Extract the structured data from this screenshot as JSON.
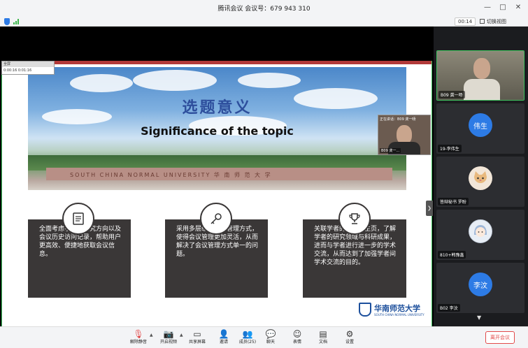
{
  "window": {
    "title": "腾讯会议 会议号：679 943 310"
  },
  "subbar": {
    "timer": "00:14",
    "switch_view": "切换视图"
  },
  "mini_player": {
    "label": "全屏",
    "time_a": "0:00:16",
    "time_b": "0:01:16"
  },
  "slide": {
    "title_cn": "选题意义",
    "title_en": "Significance of the topic",
    "wall_text": "SOUTH CHINA NORMAL UNIVERSITY  华 南 师 范 大 学",
    "cards": [
      {
        "icon": "document-icon",
        "text": "全面考虑学者的研究方向以及会议历史访问记录，帮助用户更高效、便捷地获取会议信息。"
      },
      {
        "icon": "key-icon",
        "text": "采用多层级的会议管理方式，使得会议管理更加灵活，从而解决了会议管理方式单一的问题。"
      },
      {
        "icon": "trophy-icon",
        "text": "关联学者的学者网主页，了解学者的研究领域与科研成果，进而与学者进行进一步的学术交流，从而达到了加强学者间学术交流的目的。"
      }
    ],
    "logo_name": "华南师范大学",
    "logo_en": "SOUTH CHINA NORMAL UNIVERSITY"
  },
  "pip": {
    "top_label": "正在讲话：B09 龚一旸",
    "bottom_label": "B09 龚一…"
  },
  "participants": [
    {
      "name": "B09 龚一旸",
      "type": "video"
    },
    {
      "name": "19-李伟生",
      "type": "avatar",
      "initials": "伟生",
      "color": "#2d7be5"
    },
    {
      "name": "答辩秘书 罗盼",
      "type": "avatar-cat",
      "color": "#f2e6d8"
    },
    {
      "name": "810+韩豫鑫",
      "type": "avatar-girl",
      "color": "#e8eef6"
    },
    {
      "name": "B02 李汶",
      "type": "avatar",
      "initials": "李汶",
      "color": "#2d7be5"
    }
  ],
  "toolbar": {
    "items": [
      {
        "label": "解除静音",
        "icon": "mic-muted-icon"
      },
      {
        "label": "开启视频",
        "icon": "camera-off-icon"
      },
      {
        "label": "共享屏幕",
        "icon": "share-screen-icon"
      },
      {
        "label": "邀请",
        "icon": "invite-icon"
      },
      {
        "label": "成员(25)",
        "icon": "members-icon"
      },
      {
        "label": "聊天",
        "icon": "chat-icon"
      },
      {
        "label": "表情",
        "icon": "emoji-icon"
      },
      {
        "label": "文档",
        "icon": "document-icon"
      },
      {
        "label": "设置",
        "icon": "settings-icon"
      }
    ],
    "leave": "离开会议"
  },
  "colors": {
    "accent": "#2d7be5",
    "danger": "#e24a4a",
    "active_border": "#3ec25e",
    "slide_red": "#b23a3a"
  }
}
